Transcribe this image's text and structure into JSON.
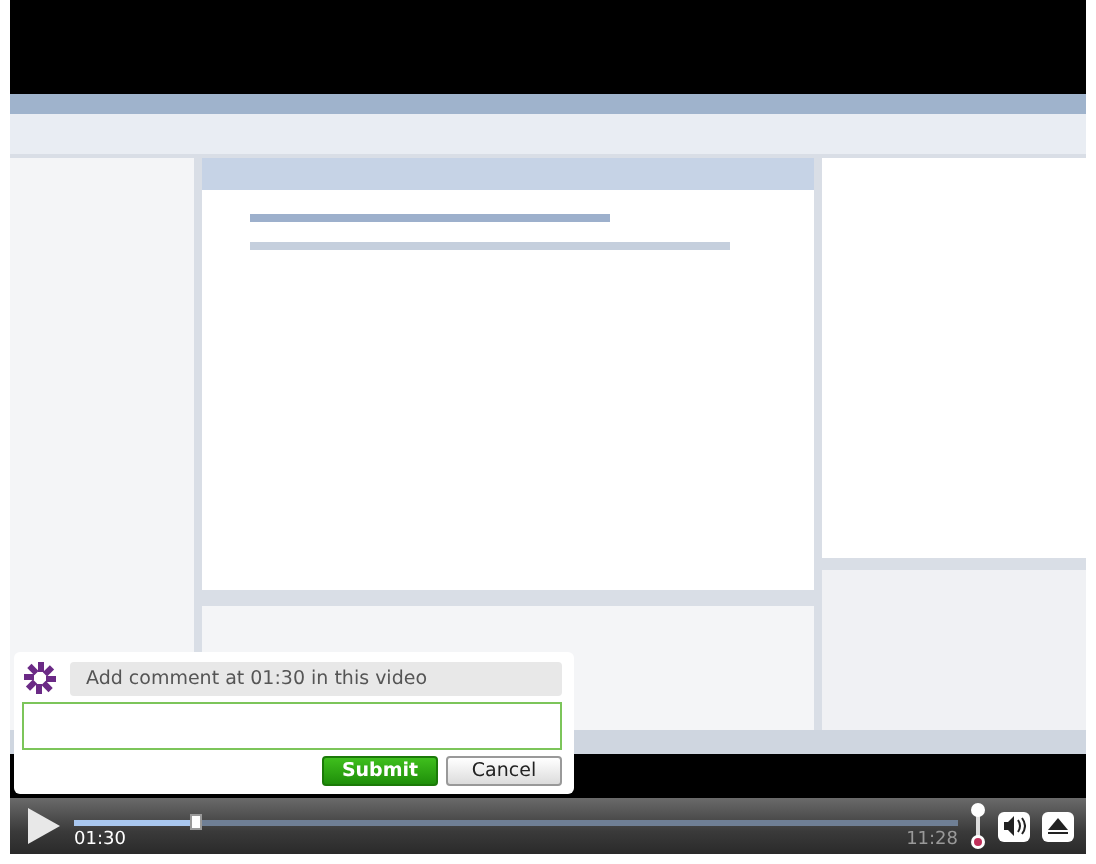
{
  "comment_box": {
    "prompt": "Add comment at 01:30 in this video",
    "buttons": [
      {
        "label": "Submit",
        "kind": "primary"
      },
      {
        "label": "Cancel",
        "kind": "secondary"
      }
    ]
  },
  "controls": {
    "elapsed": "01:30",
    "duration": "11:28",
    "progress": {
      "level": 0.137
    }
  }
}
